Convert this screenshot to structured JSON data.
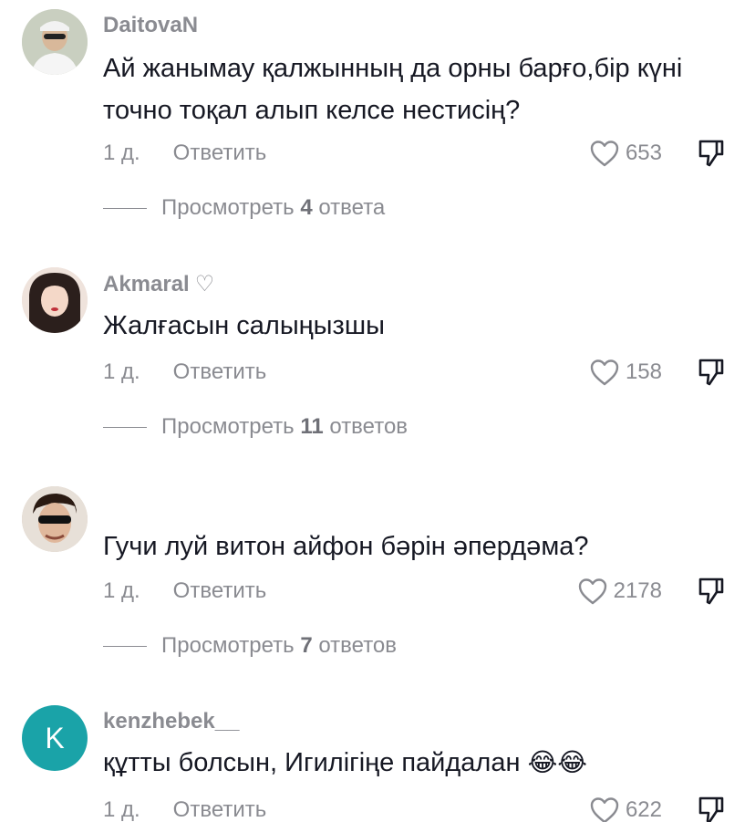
{
  "comments": [
    {
      "username": "DaitovaN",
      "text": "Ай жанымау қалжынның да орны барғо,бір күні точно тоқал алып келсе нестисің?",
      "time": "1 д.",
      "reply": "Ответить",
      "likes": "653",
      "view_replies": {
        "prefix": "Просмотреть ",
        "count": "4",
        "suffix": " ответа"
      }
    },
    {
      "username": "Akmaral",
      "username_suffix": "♡",
      "text": "Жалғасын салыңызшы",
      "time": "1 д.",
      "reply": "Ответить",
      "likes": "158",
      "view_replies": {
        "prefix": "Просмотреть ",
        "count": "11",
        "suffix": " ответов"
      }
    },
    {
      "username": "",
      "text": "Гучи луй витон айфон бәрін әпердәма?",
      "time": "1 д.",
      "reply": "Ответить",
      "likes": "2178",
      "view_replies": {
        "prefix": "Просмотреть ",
        "count": "7",
        "suffix": " ответов"
      }
    },
    {
      "username": "kenzhebek__",
      "avatar_letter": "K",
      "text": "құтты болсын, Игилігіңе пайдалан",
      "emoji": "😂😂",
      "time": "1 д.",
      "reply": "Ответить",
      "likes": "622"
    }
  ],
  "colors": {
    "muted": "#8a8b91",
    "text": "#161823",
    "avatar_teal": "#1aa3a8"
  }
}
